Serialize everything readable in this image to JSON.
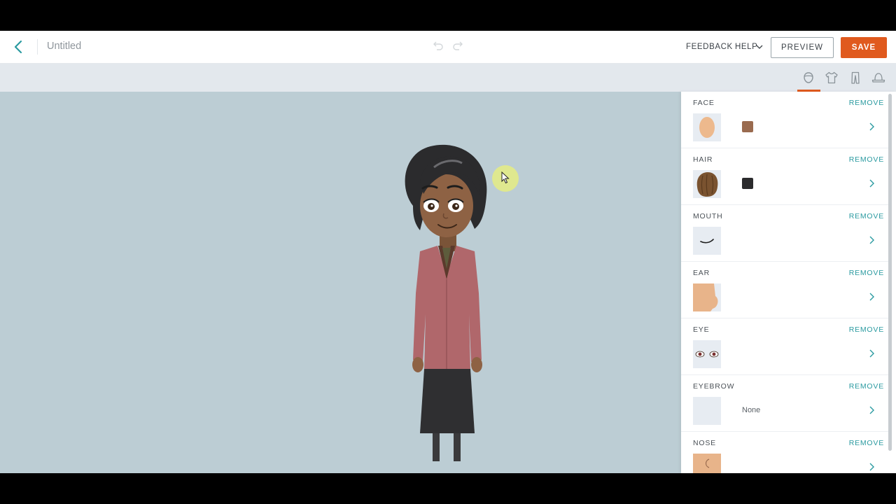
{
  "header": {
    "title": "Untitled",
    "feedback_label": "FEEDBACK",
    "help_label": "HELP",
    "preview_label": "PREVIEW",
    "save_label": "SAVE"
  },
  "icons": {
    "back": "chevron-left-icon",
    "undo": "undo-icon",
    "redo": "redo-icon",
    "help_dropdown": "chevron-down-icon"
  },
  "category_tabs": [
    {
      "icon": "head-icon",
      "active": true
    },
    {
      "icon": "shirt-icon",
      "active": false
    },
    {
      "icon": "pants-icon",
      "active": false
    },
    {
      "icon": "hat-icon",
      "active": false
    }
  ],
  "colors": {
    "accent": "#e05a1e",
    "link": "#2a9aa0",
    "stage": "#bccdd4"
  },
  "panel": {
    "remove_label": "REMOVE",
    "sections": [
      {
        "label": "FACE",
        "swatch": "#9a6b4f"
      },
      {
        "label": "HAIR",
        "swatch": "#2b2b2d"
      },
      {
        "label": "MOUTH"
      },
      {
        "label": "EAR"
      },
      {
        "label": "EYE"
      },
      {
        "label": "EYEBROW",
        "value": "None"
      },
      {
        "label": "NOSE"
      }
    ]
  }
}
